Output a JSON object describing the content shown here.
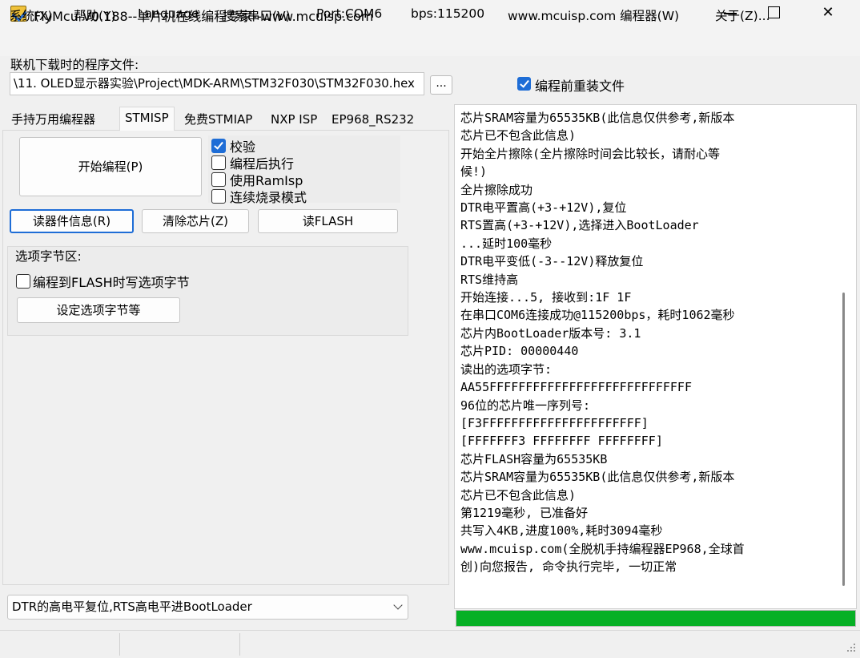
{
  "window": {
    "title": "FlyMcu V0.188--单片机在线编程专家--www.mcuisp.com",
    "minimize": "–",
    "maximize": "☐",
    "close": "✕"
  },
  "menu": [
    "系统(X)",
    "帮助(Y)",
    "Language",
    "搜索串口(V)",
    "Port:COM6",
    "bps:115200",
    "www.mcuisp.com 编程器(W)",
    "关于(Z)..."
  ],
  "file": {
    "label": "联机下载时的程序文件:",
    "path": "\\11. OLED显示器实验\\Project\\MDK-ARM\\STM32F030\\STM32F030.hex",
    "browse_label": "...",
    "reload_label": "编程前重装文件",
    "reload_checked": true
  },
  "tabs": [
    "手持万用编程器",
    "STMISP",
    "免费STMIAP",
    "NXP ISP",
    "EP968_RS232"
  ],
  "active_tab": "STMISP",
  "stmisp": {
    "start_button": "开始编程(P)",
    "options": [
      {
        "label": "校验",
        "checked": true
      },
      {
        "label": "编程后执行",
        "checked": false
      },
      {
        "label": "使用RamIsp",
        "checked": false
      },
      {
        "label": "连续烧录模式",
        "checked": false
      }
    ],
    "read_info_button": "读器件信息(R)",
    "erase_button": "清除芯片(Z)",
    "read_flash_button": "读FLASH",
    "option_group_title": "选项字节区:",
    "write_option_label": "编程到FLASH时写选项字节",
    "write_option_checked": false,
    "set_option_button": "设定选项字节等",
    "reset_mode": "DTR的高电平复位,RTS高电平进BootLoader"
  },
  "log": [
    "芯片SRAM容量为65535KB(此信息仅供参考,新版本",
    "芯片已不包含此信息)",
    "开始全片擦除(全片擦除时间会比较长，请耐心等",
    "候!)",
    "全片擦除成功",
    "DTR电平置高(+3-+12V),复位",
    "RTS置高(+3-+12V),选择进入BootLoader",
    "...延时100毫秒",
    "DTR电平变低(-3--12V)释放复位",
    "RTS维持高",
    "开始连接...5, 接收到:1F 1F",
    "在串口COM6连接成功@115200bps，耗时1062毫秒",
    "芯片内BootLoader版本号: 3.1",
    "芯片PID: 00000440",
    "读出的选项字节:",
    "AA55FFFFFFFFFFFFFFFFFFFFFFFFFFFF",
    "96位的芯片唯一序列号:",
    "[F3FFFFFFFFFFFFFFFFFFFFFF]",
    "[FFFFFFF3 FFFFFFFF FFFFFFFF]",
    "芯片FLASH容量为65535KB",
    "芯片SRAM容量为65535KB(此信息仅供参考,新版本",
    "芯片已不包含此信息)",
    "第1219毫秒, 已准备好",
    "共写入4KB,进度100%,耗时3094毫秒",
    "www.mcuisp.com(全脱机手持编程器EP968,全球首",
    "创)向您报告, 命令执行完毕, 一切正常"
  ],
  "progress": 1.0,
  "colors": {
    "accent": "#1e6dd6",
    "progress": "#06b025"
  }
}
